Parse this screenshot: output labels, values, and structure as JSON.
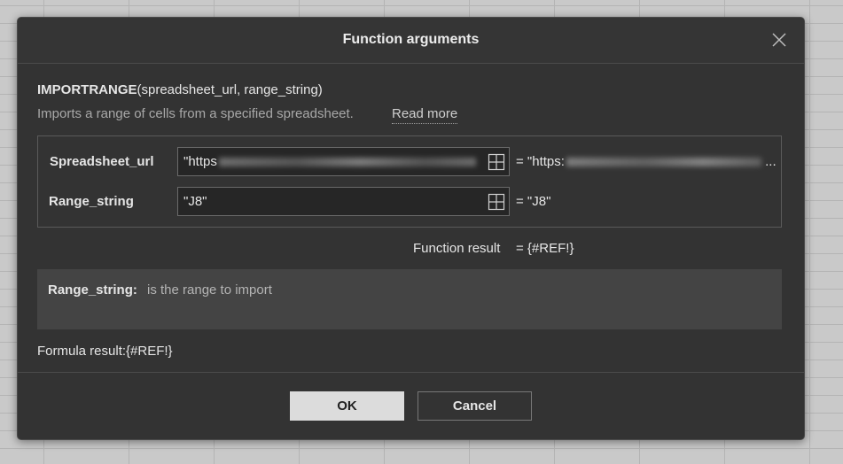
{
  "dialog": {
    "title": "Function arguments",
    "function_name": "IMPORTRANGE",
    "function_params": "(spreadsheet_url, range_string)",
    "description": "Imports a range of cells from a specified spreadsheet.",
    "read_more": "Read more"
  },
  "args": [
    {
      "label": "Spreadsheet_url",
      "value": "\"https",
      "result": "= \"https:",
      "ellipsis": "..."
    },
    {
      "label": "Range_string",
      "value": "\"J8\"",
      "result": "= \"J8\""
    }
  ],
  "function_result": {
    "label": "Function result",
    "value": "= {#REF!}"
  },
  "help": {
    "arg_name": "Range_string:",
    "text": "is the range to import"
  },
  "formula_result": "Formula result:{#REF!}",
  "buttons": {
    "ok": "OK",
    "cancel": "Cancel"
  },
  "icons": {
    "close": "close-icon",
    "range_select": "range-select-icon"
  }
}
